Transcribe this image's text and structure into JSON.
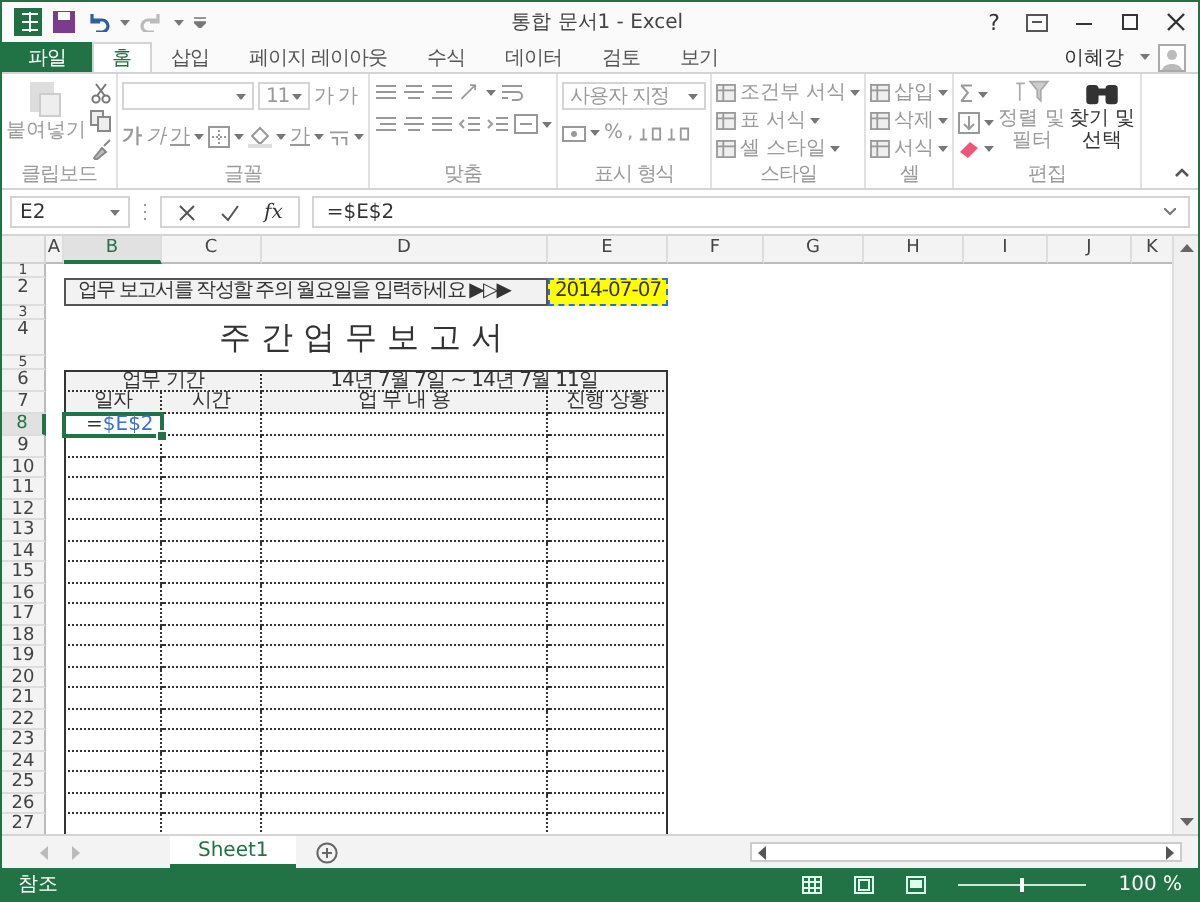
{
  "window": {
    "title": "통합 문서1 - Excel",
    "help": "?",
    "user": "이혜강"
  },
  "ribbon_tabs": [
    {
      "label": "파일",
      "kind": "file",
      "selected": false
    },
    {
      "label": "홈",
      "kind": "tab",
      "selected": true
    },
    {
      "label": "삽입",
      "kind": "tab",
      "selected": false
    },
    {
      "label": "페이지 레이아웃",
      "kind": "tab",
      "selected": false
    },
    {
      "label": "수식",
      "kind": "tab",
      "selected": false
    },
    {
      "label": "데이터",
      "kind": "tab",
      "selected": false
    },
    {
      "label": "검토",
      "kind": "tab",
      "selected": false
    },
    {
      "label": "보기",
      "kind": "tab",
      "selected": false
    }
  ],
  "ribbon": {
    "disabled": true,
    "groups": [
      {
        "kind": "clipboard",
        "label": "클립보드",
        "paste": "붙여넣기"
      },
      {
        "kind": "font",
        "label": "글꼴",
        "size": "11",
        "grow": "가",
        "shrink": "가",
        "bold": "가",
        "italic": "가",
        "underline": "가",
        "font_color": "가"
      },
      {
        "kind": "alignment",
        "label": "맞춤"
      },
      {
        "kind": "number",
        "label": "표시 형식",
        "format": "사용자 지정",
        "percent": "%",
        "comma": ","
      },
      {
        "kind": "styles",
        "label": "스타일",
        "items": [
          "조건부 서식",
          "표 서식",
          "셀 스타일"
        ]
      },
      {
        "kind": "cells",
        "label": "셀",
        "items": [
          "삽입",
          "삭제",
          "서식"
        ]
      },
      {
        "kind": "editing",
        "label": "편집",
        "sum": "Σ",
        "sort": [
          "정렬 및",
          "필터"
        ],
        "find": [
          "찾기 및",
          "선택"
        ]
      }
    ]
  },
  "formula_bar": {
    "name_box": "E2",
    "fx": "fx",
    "formula": "=$E$2"
  },
  "sheet": {
    "columns": [
      {
        "label": "A",
        "selected": false
      },
      {
        "label": "B",
        "selected": true
      },
      {
        "label": "C",
        "selected": false
      },
      {
        "label": "D",
        "selected": false
      },
      {
        "label": "E",
        "selected": false
      },
      {
        "label": "F",
        "selected": false
      },
      {
        "label": "G",
        "selected": false
      },
      {
        "label": "H",
        "selected": false
      },
      {
        "label": "I",
        "selected": false
      },
      {
        "label": "J",
        "selected": false
      },
      {
        "label": "K",
        "selected": false
      }
    ],
    "rows": [
      {
        "label": "1",
        "selected": false,
        "in_table": false
      },
      {
        "label": "2",
        "selected": false,
        "in_table": false,
        "cells": [
          {
            "kind": "banner",
            "text": "업무 보고서를 작성할 주의 월요일을 입력하세요  ▶▷▶"
          },
          {
            "kind": "date",
            "text": "2014-07-07",
            "copied": true
          }
        ]
      },
      {
        "label": "3",
        "selected": false,
        "in_table": false
      },
      {
        "label": "4",
        "selected": false,
        "in_table": false,
        "cells": [
          {
            "kind": "title",
            "text": "주간업무보고서"
          }
        ]
      },
      {
        "label": "5",
        "selected": false,
        "in_table": false
      },
      {
        "label": "6",
        "selected": false,
        "in_table": true,
        "cells": [
          {
            "kind": "group_header",
            "text": "업무 기간"
          },
          {
            "kind": "group_header",
            "text": "14년 7월 7일 ~ 14년 7월 11일"
          }
        ]
      },
      {
        "label": "7",
        "selected": false,
        "in_table": true,
        "cells": [
          {
            "kind": "header",
            "text": "일자"
          },
          {
            "kind": "header",
            "text": "시간"
          },
          {
            "kind": "header",
            "text": "업 무 내 용"
          },
          {
            "kind": "header",
            "text": "진행 상황"
          }
        ]
      },
      {
        "label": "8",
        "selected": true,
        "in_table": true,
        "cells": [
          {
            "kind": "editing",
            "prefix": "=",
            "reference": "$E$2"
          }
        ]
      },
      {
        "label": "9",
        "selected": false,
        "in_table": true
      },
      {
        "label": "10",
        "selected": false,
        "in_table": true
      },
      {
        "label": "11",
        "selected": false,
        "in_table": true
      },
      {
        "label": "12",
        "selected": false,
        "in_table": true
      },
      {
        "label": "13",
        "selected": false,
        "in_table": true
      },
      {
        "label": "14",
        "selected": false,
        "in_table": true
      },
      {
        "label": "15",
        "selected": false,
        "in_table": true
      },
      {
        "label": "16",
        "selected": false,
        "in_table": true
      },
      {
        "label": "17",
        "selected": false,
        "in_table": true
      },
      {
        "label": "18",
        "selected": false,
        "in_table": true
      },
      {
        "label": "19",
        "selected": false,
        "in_table": true
      },
      {
        "label": "20",
        "selected": false,
        "in_table": true
      },
      {
        "label": "21",
        "selected": false,
        "in_table": true
      },
      {
        "label": "22",
        "selected": false,
        "in_table": true
      },
      {
        "label": "23",
        "selected": false,
        "in_table": true
      },
      {
        "label": "24",
        "selected": false,
        "in_table": true
      },
      {
        "label": "25",
        "selected": false,
        "in_table": true
      },
      {
        "label": "26",
        "selected": false,
        "in_table": true
      },
      {
        "label": "27",
        "selected": false,
        "in_table": true
      }
    ]
  },
  "sheet_tabs": [
    {
      "label": "Sheet1",
      "selected": true
    }
  ],
  "status_bar": {
    "mode": "참조",
    "zoom": {
      "level": 0.5
    },
    "zoom_label": "100 %"
  }
}
